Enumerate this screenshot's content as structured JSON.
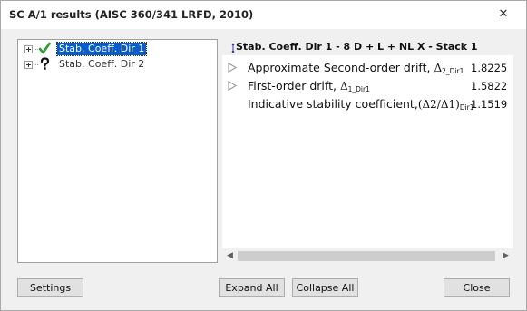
{
  "window": {
    "title": "SC A/1 results (AISC 360/341 LRFD, 2010)",
    "close_glyph": "✕"
  },
  "tree": {
    "items": [
      {
        "label": "Stab. Coeff. Dir 1",
        "icon": "green-check-icon",
        "selected": true
      },
      {
        "label": "Stab. Coeff. Dir 2",
        "icon": "question-mark-icon",
        "selected": false
      }
    ]
  },
  "results": {
    "header": "Stab. Coeff. Dir 1 - 8 D + L + NL X - Stack 1",
    "rows": [
      {
        "label": "Approximate Second-order drift,",
        "symbol": "Δ",
        "subscript": "2_Dir1",
        "value": "1.8225",
        "expandable": true
      },
      {
        "label": "First-order drift,",
        "symbol": "Δ",
        "subscript": "1_Dir1",
        "value": "1.5822",
        "expandable": true
      },
      {
        "label": "Indicative stability coefficient,",
        "symbol": "(Δ2/Δ1)",
        "subscript": "Dir1",
        "value": "1.1519",
        "expandable": false
      }
    ],
    "scroll_left_glyph": "◀",
    "scroll_right_glyph": "▶"
  },
  "buttons": {
    "settings": "Settings",
    "expand_all": "Expand All",
    "collapse_all": "Collapse All",
    "close": "Close"
  },
  "colors": {
    "selection": "#0a5dcc",
    "check": "#2e9b2e",
    "header_glyph": "#3a3aa0"
  }
}
